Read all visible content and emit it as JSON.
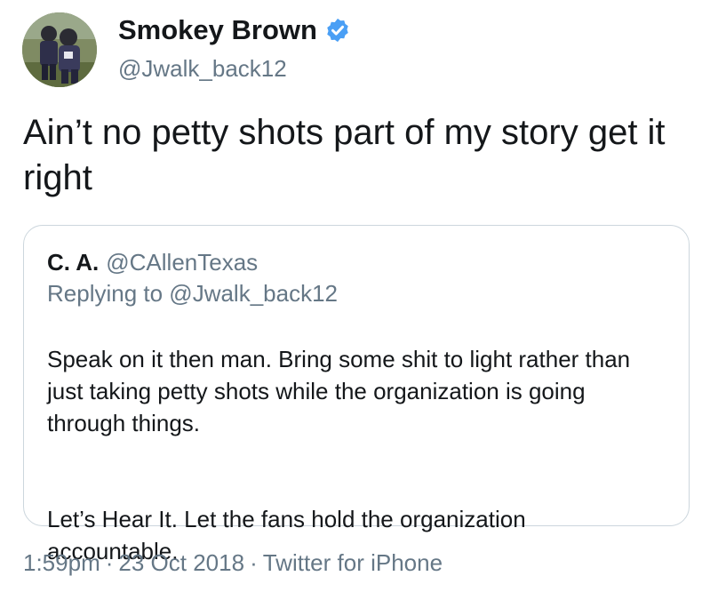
{
  "author": {
    "name": "Smokey Brown",
    "handle": "@Jwalk_back12",
    "verified_icon": "verified-badge-icon",
    "verified_color": "#4a9ff5"
  },
  "tweet": {
    "text": "Ain’t no petty shots part of my story get it right"
  },
  "quoted_tweet": {
    "name": "C. A.",
    "handle": "@CAllenTexas",
    "replying_to": "Replying to @Jwalk_back12",
    "paragraphs": [
      "Speak on it then man.   Bring some shit to light rather than just taking petty shots while the organization is going through things.",
      "Let’s Hear It.   Let the fans hold the organization accountable."
    ]
  },
  "meta": {
    "time": "1:59pm",
    "date": "23 Oct 2018",
    "source": "Twitter for iPhone",
    "separator": "·"
  },
  "colors": {
    "text_primary": "#14171a",
    "text_secondary": "#657786",
    "border": "#ccd6dd"
  }
}
